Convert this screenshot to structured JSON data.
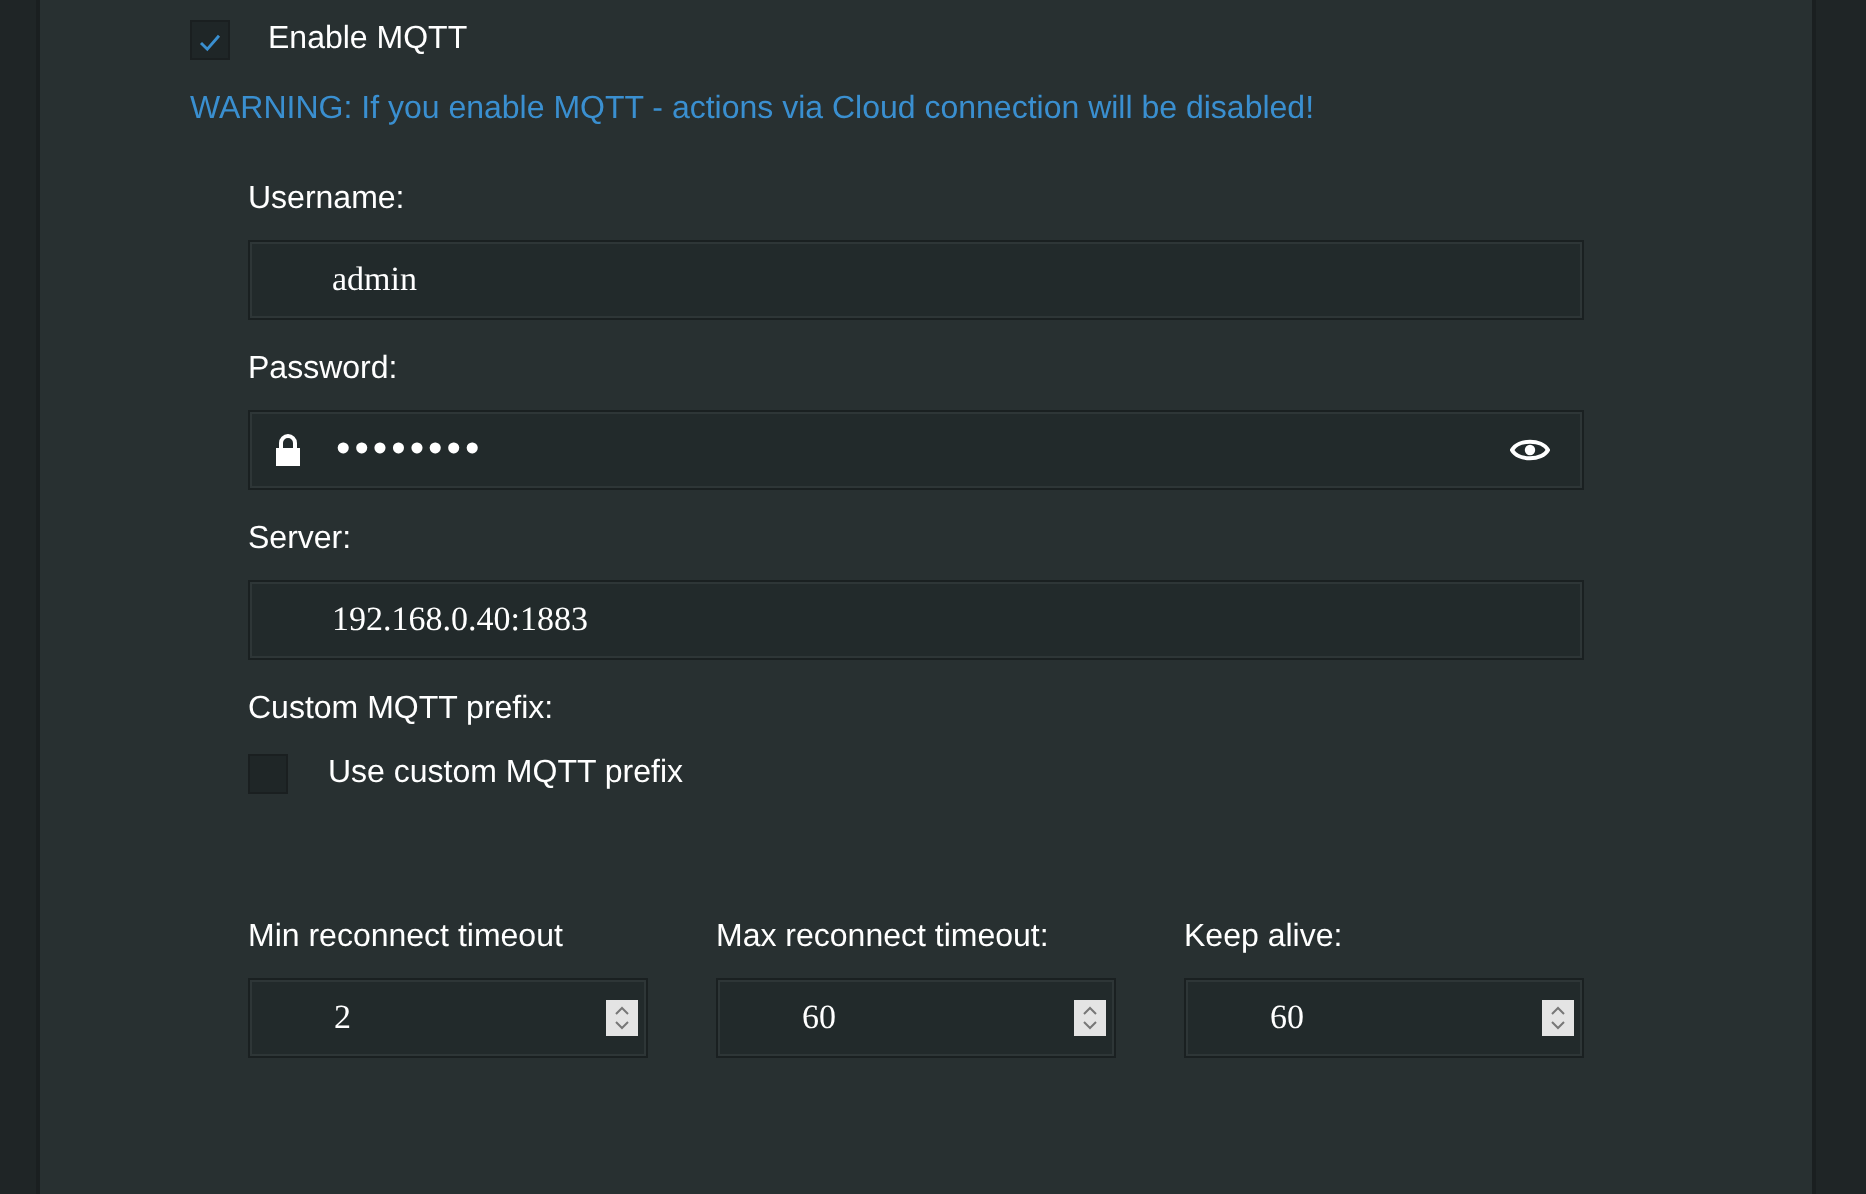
{
  "enable_mqtt": {
    "label": "Enable MQTT",
    "checked": true
  },
  "warning": "WARNING: If you enable MQTT - actions via Cloud connection will be disabled!",
  "fields": [
    {
      "kind": "text",
      "label": "Username:",
      "value": "admin"
    },
    {
      "kind": "password",
      "label": "Password:",
      "value": "••••••••"
    },
    {
      "kind": "text",
      "label": "Server:",
      "value": "192.168.0.40:1883"
    }
  ],
  "custom_prefix": {
    "label": "Custom MQTT prefix:",
    "option": {
      "label": "Use custom MQTT prefix",
      "checked": false
    }
  },
  "timeouts": [
    {
      "label": "Min reconnect timeout",
      "value": "2"
    },
    {
      "label": "Max reconnect timeout:",
      "value": "60"
    },
    {
      "label": "Keep alive:",
      "value": "60"
    }
  ]
}
